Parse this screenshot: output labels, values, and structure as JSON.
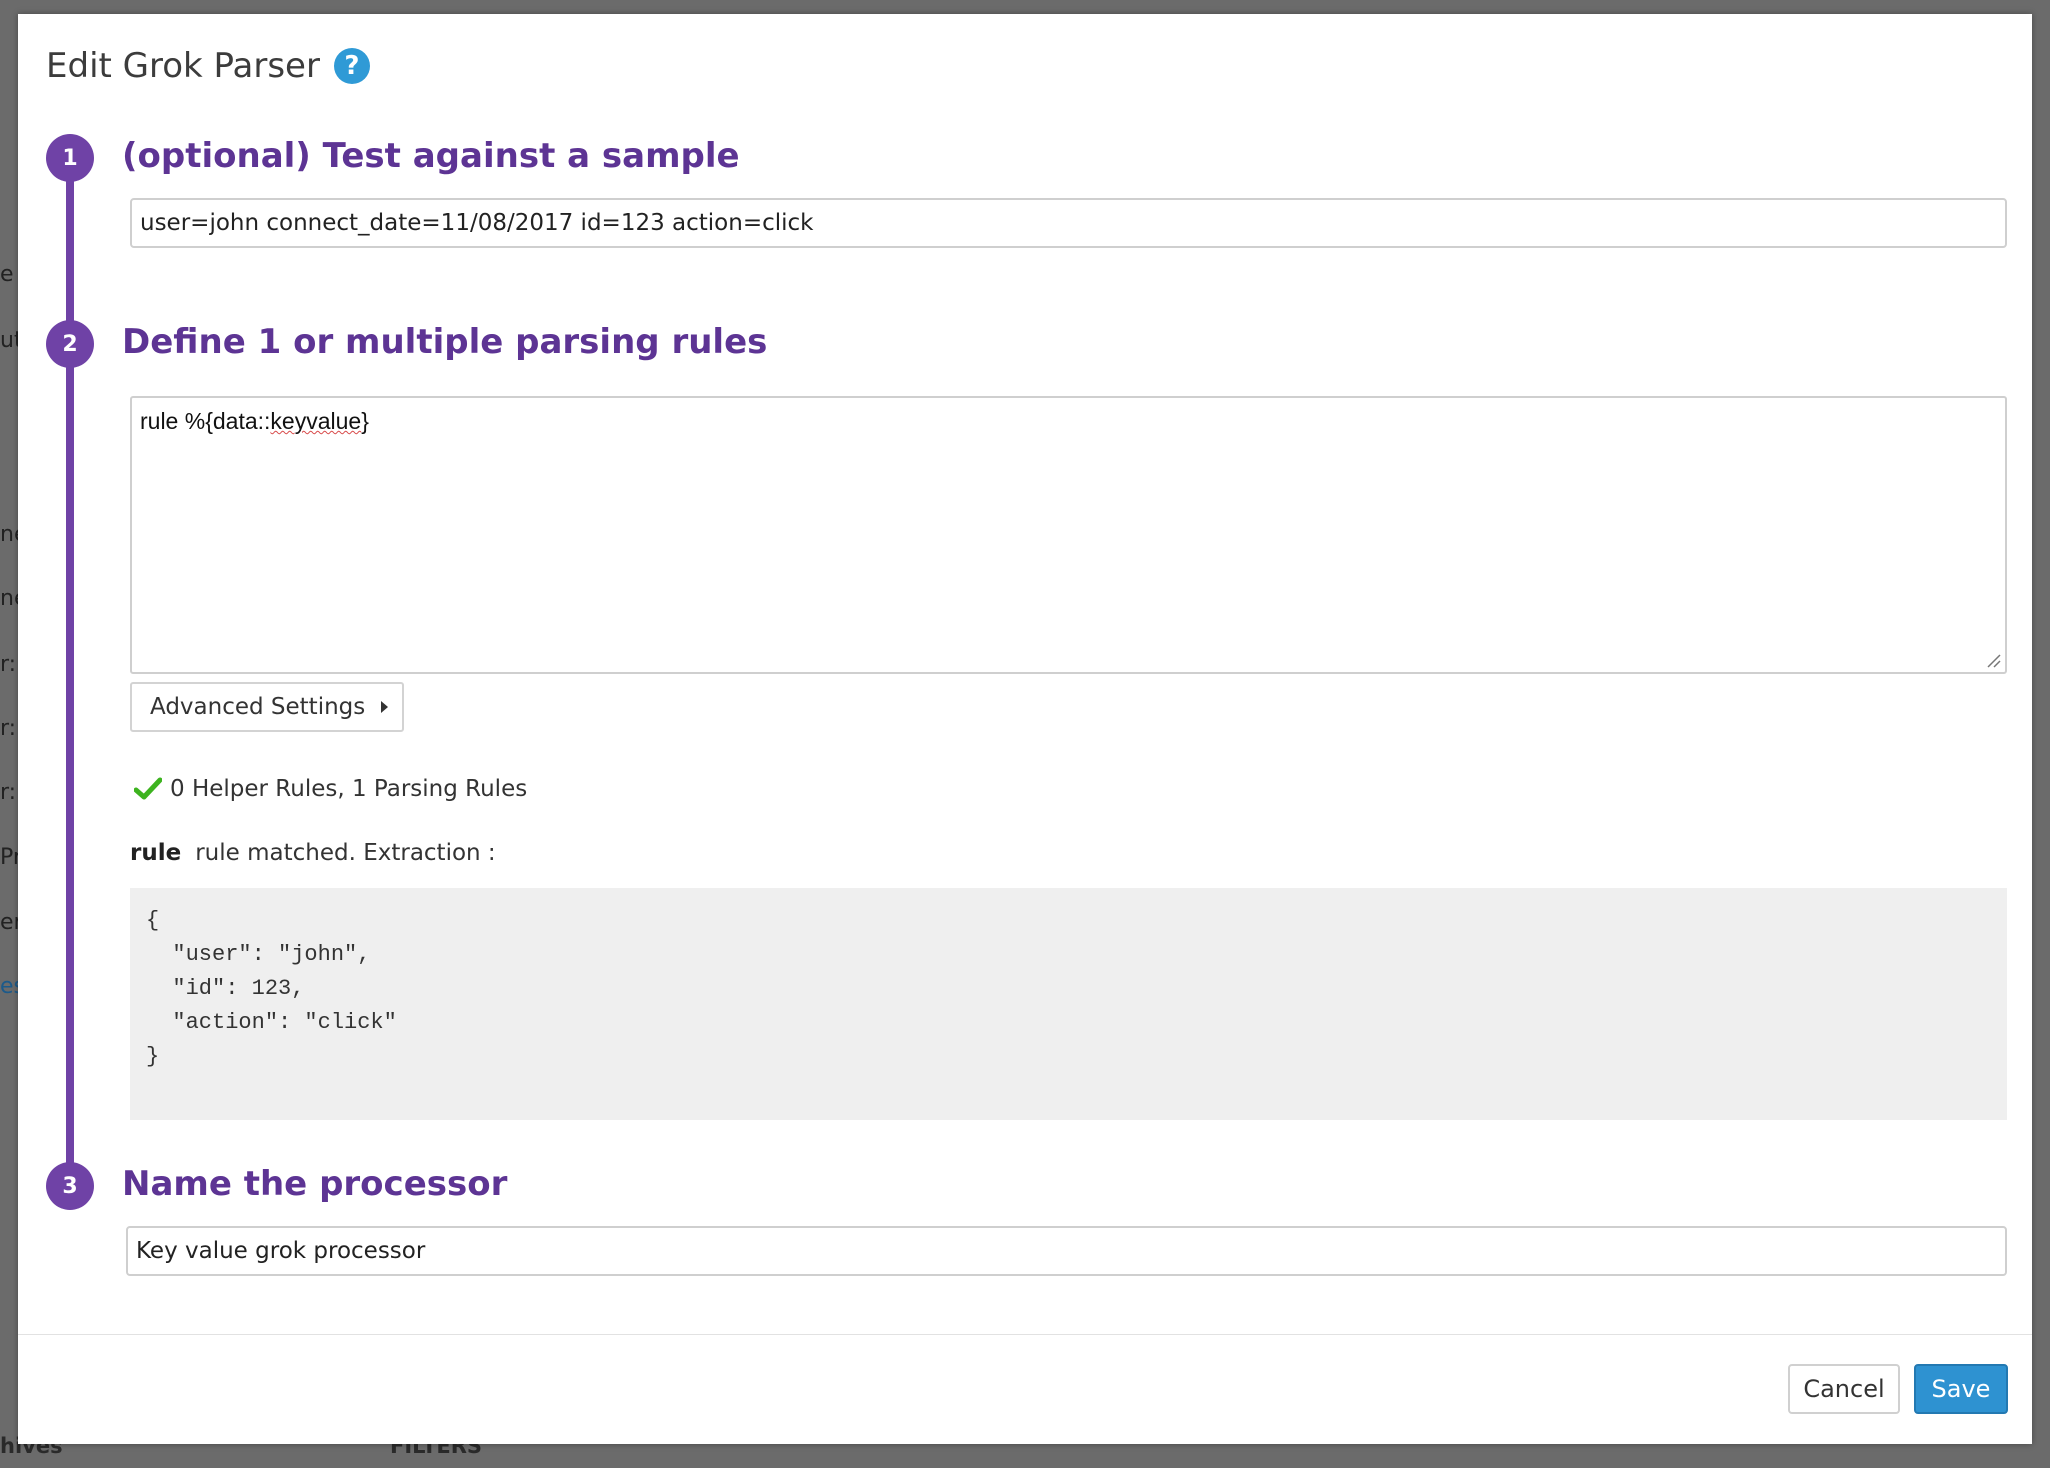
{
  "background": {
    "fragments": [
      "e",
      "ut",
      "ne",
      "ne",
      "r:",
      "r:",
      "r:",
      "Pr",
      "er",
      "es"
    ],
    "bottom_left": "hives",
    "bottom_mid": "FILTERS"
  },
  "modal": {
    "title": "Edit Grok Parser",
    "help_icon": "?"
  },
  "steps": [
    {
      "number": "1",
      "title": "(optional) Test against a sample"
    },
    {
      "number": "2",
      "title": "Define 1 or multiple parsing rules"
    },
    {
      "number": "3",
      "title": "Name the processor"
    }
  ],
  "sample": {
    "value": "user=john connect_date=11/08/2017 id=123 action=click"
  },
  "rules": {
    "prefix": "rule %{data::",
    "underlined": "keyvalue",
    "suffix": "}"
  },
  "advanced_settings": {
    "label": "Advanced Settings"
  },
  "status": {
    "text": "0 Helper Rules, 1 Parsing Rules"
  },
  "match": {
    "rule_name": "rule",
    "message": "rule matched. Extraction :"
  },
  "extraction": {
    "lines": [
      "{",
      "  \"user\": \"john\",",
      "  \"id\": 123,",
      "  \"action\": \"click\"",
      "}"
    ]
  },
  "processor_name": {
    "value": "Key value grok processor"
  },
  "buttons": {
    "cancel": "Cancel",
    "save": "Save"
  },
  "colors": {
    "accent_purple": "#6f42a6",
    "title_purple": "#5d3494",
    "primary_blue": "#2e92d1",
    "success_green": "#3db31f"
  }
}
